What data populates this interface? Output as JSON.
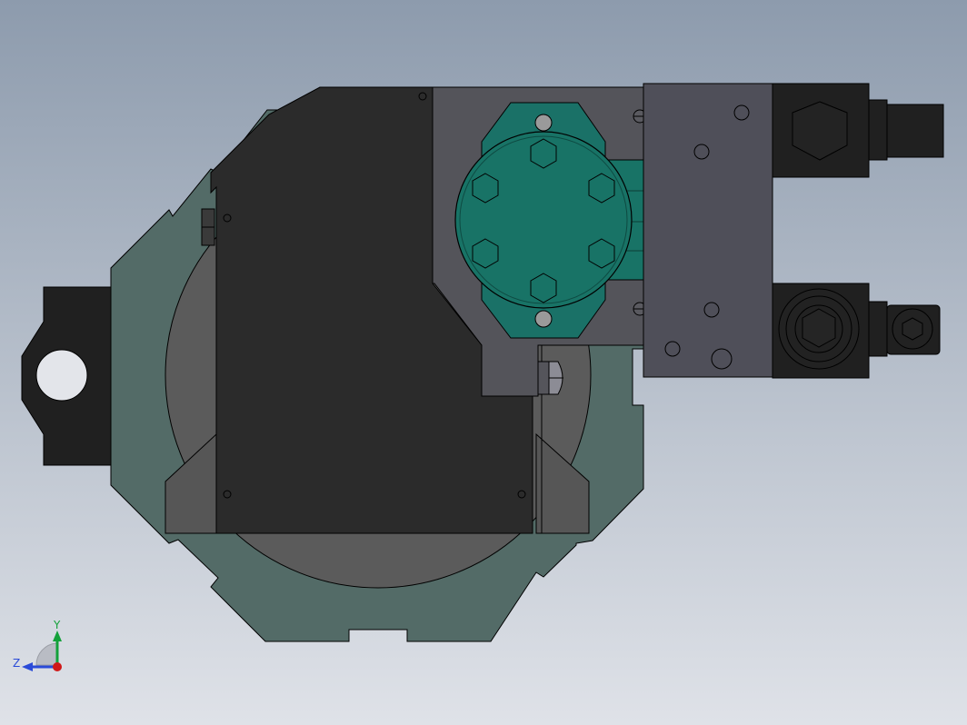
{
  "viewport": {
    "background_top": "#8d9bad",
    "background_bottom": "#dfe2e8"
  },
  "colors": {
    "octagon_plate": "#536b67",
    "disc": "#5b5b5b",
    "dark_block": "#2b2b2b",
    "grey_plate": "#54545a",
    "teal_flange": "#1a7167",
    "teal_motor": "#187366",
    "manifold": "#4f4f59",
    "black_parts": "#202020",
    "edge": "#000000"
  },
  "triad": {
    "y_label": "Y",
    "z_label": "Z",
    "y_color": "#13a13a",
    "z_color": "#2a4ad8",
    "x_color": "#d01818"
  }
}
